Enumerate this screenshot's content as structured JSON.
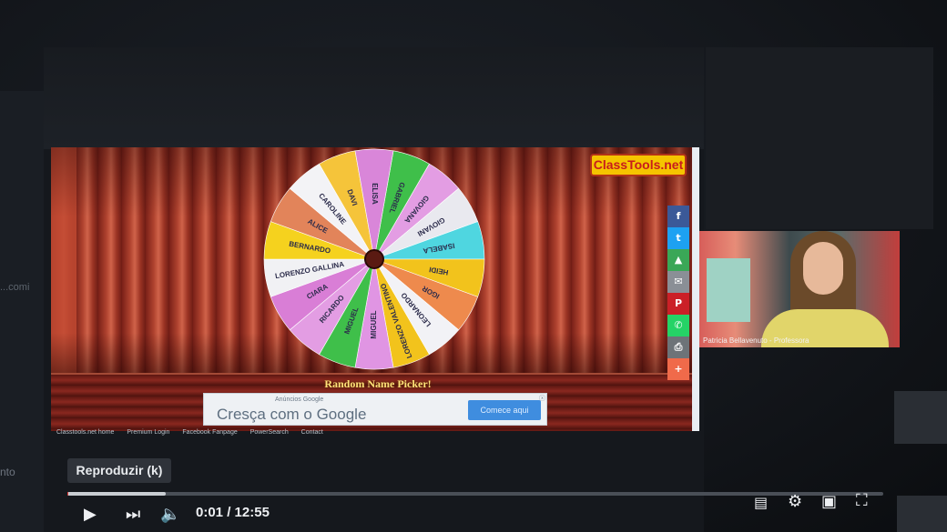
{
  "video": {
    "tooltip": "Reproduzir (k)",
    "current_time": "0:01",
    "separator": " / ",
    "duration": "12:55",
    "progress_played": 0.0013,
    "progress_buffered": 0.12
  },
  "app": {
    "logo": "ClassTools.net",
    "title": "Random Name Picker!"
  },
  "wheel": {
    "names": [
      "GABRIEL",
      "GIOVANA",
      "GIOVANI",
      "ISABELA",
      "HEIDI",
      "IGOR",
      "LEONARDO",
      "LORENZO VALENTINO",
      "MIGUEL",
      "MIGUEL",
      "RICARDO",
      "CIARA",
      "LORENZO GALLINA",
      "BERNARDO",
      "ALICE",
      "CAROLINE",
      "DAVI",
      "ELISA"
    ],
    "colors": [
      "#3fbf4a",
      "#e39de3",
      "#e9e9ef",
      "#4fd6e0",
      "#f2c31c",
      "#ee8a4d",
      "#f2f2f6",
      "#f2c31c",
      "#e095e3",
      "#3fbf4a",
      "#e39de3",
      "#d97ed6",
      "#f1f1f4",
      "#f5d21e",
      "#e2845a",
      "#f3f3f6",
      "#f5c43a",
      "#d986d9"
    ]
  },
  "share": {
    "icons": [
      "facebook-icon",
      "twitter-icon",
      "upload-icon",
      "email-icon",
      "pinterest-icon",
      "whatsapp-icon",
      "print-icon",
      "plus-icon"
    ],
    "glyphs": [
      "f",
      "t",
      "▲",
      "✉",
      "P",
      "✆",
      "⎙",
      "+"
    ],
    "colors": [
      "#3b5998",
      "#1da1f2",
      "#3aa757",
      "#8a8f96",
      "#cb2027",
      "#25d366",
      "#6d7378",
      "#f06a4a"
    ]
  },
  "ad": {
    "small_text": "Anúncios Google",
    "headline": "Cresça com o Google",
    "cta": "Comece aqui",
    "close": "ⓧ"
  },
  "footer": {
    "links": [
      "Classtools.net home",
      "Premium Login",
      "Facebook Fanpage",
      "PowerSearch",
      "Contact"
    ]
  },
  "webcam": {
    "name": "Patricia Bellavenuto - Professora"
  },
  "screen": {
    "left_text": "nto",
    "left_text2": "...comi"
  }
}
